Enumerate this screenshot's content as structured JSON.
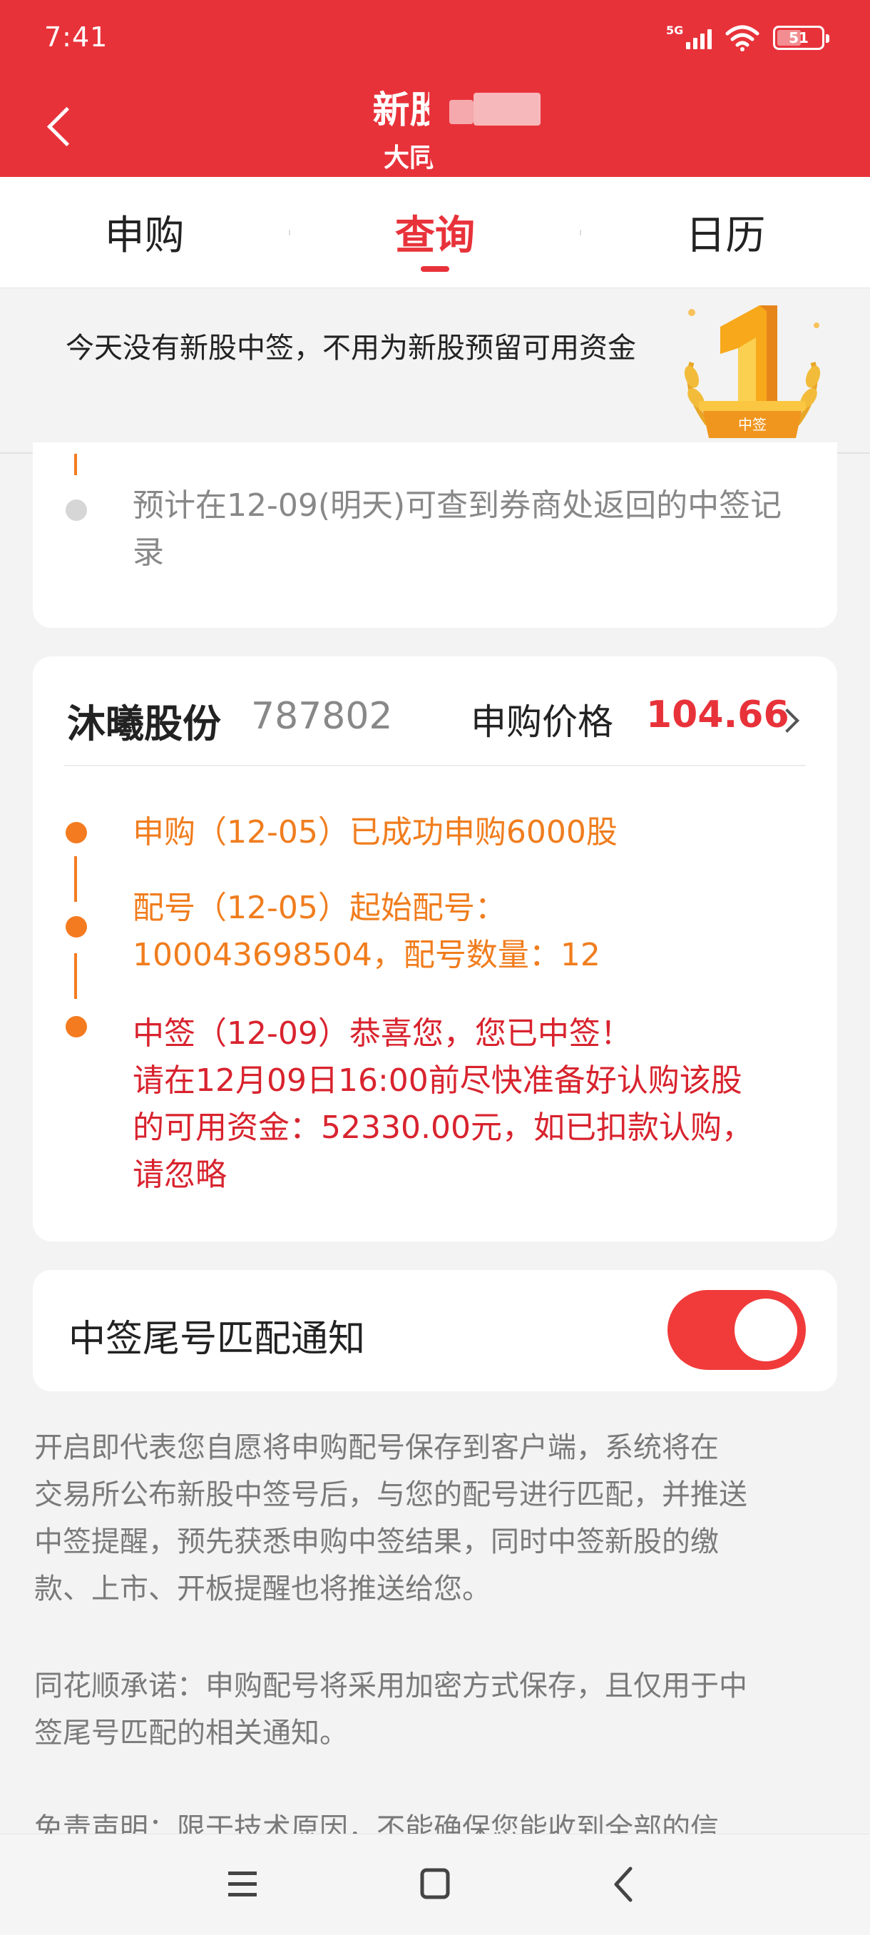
{
  "status_bar": {
    "time": "7:41",
    "network": "5G",
    "battery": "51"
  },
  "header": {
    "title": "新股/债",
    "subtitle": "大同证券"
  },
  "tabs": [
    {
      "label": "申购",
      "active": false
    },
    {
      "label": "查询",
      "active": true
    },
    {
      "label": "日历",
      "active": false
    }
  ],
  "banner": {
    "text": "今天没有新股中签，不用为新股预留可用资金",
    "badge_label": "中签",
    "badge_digit": "1"
  },
  "card1": {
    "step_text": "预计在12-09(明天)可查到券商处返回的中签记录"
  },
  "stock": {
    "name": "沐曦股份",
    "code": "787802",
    "price_label": "申购价格",
    "price_value": "104.66",
    "steps": [
      {
        "line1": "申购（12-05）已成功申购6000股",
        "line2": "",
        "line3": "",
        "line4": ""
      },
      {
        "line1": "配号（12-05）起始配号：",
        "line2": "100043698504，配号数量：12",
        "line3": "",
        "line4": ""
      },
      {
        "line1": "中签（12-09）恭喜您，您已中签！",
        "line2": "请在12月09日16:00前尽快准备好认购该股",
        "line3": "的可用资金：52330.00元，如已扣款认购，",
        "line4": "请忽略"
      }
    ]
  },
  "notify": {
    "label": "中签尾号匹配通知",
    "enabled": true
  },
  "paragraphs": {
    "p1": [
      "开启即代表您自愿将申购配号保存到客户端，系统将在",
      "交易所公布新股中签号后，与您的配号进行匹配，并推送",
      "中签提醒，预先获悉申购中签结果，同时中签新股的缴",
      "款、上市、开板提醒也将推送给您。"
    ],
    "p2": [
      "同花顺承诺：申购配号将采用加密方式保存，且仅用于中",
      "签尾号匹配的相关通知。"
    ],
    "p3": "免责声明：限于技术原因，不能确保您能收到全部的信"
  },
  "colors": {
    "primary_red": "#e8323a",
    "orange": "#f47b20",
    "toggle_on": "#f13a3a"
  },
  "icons": {
    "back": "back-arrow-icon",
    "price": "chevron-right-icon",
    "nav_menu": "menu-icon",
    "nav_home": "home-icon",
    "nav_back": "nav-back-icon"
  }
}
